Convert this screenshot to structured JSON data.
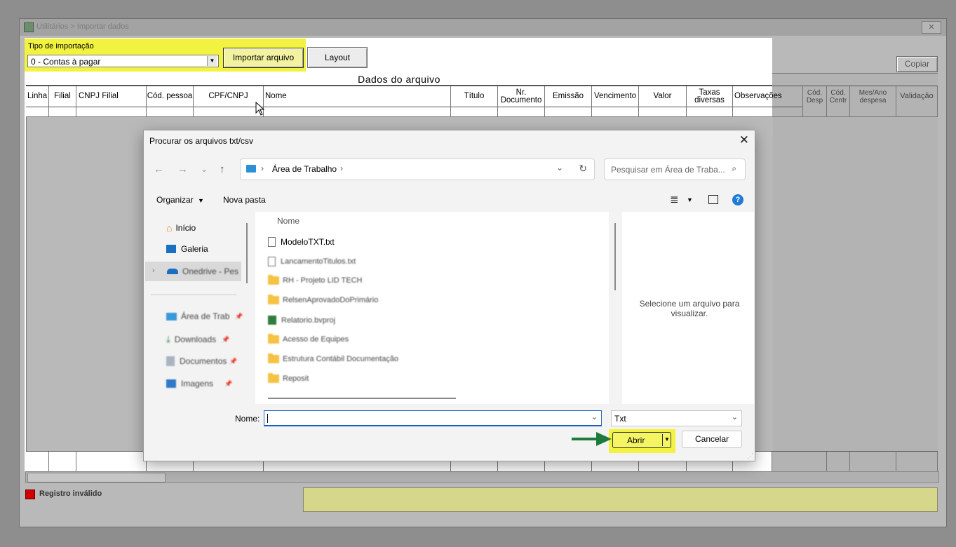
{
  "window": {
    "title": "Utilitários > Importar dados",
    "close_glyph": "✕"
  },
  "toolbar": {
    "import_type_label": "Tipo de importação",
    "import_type_value": "0 - Contas à pagar",
    "import_file_button": "Importar arquivo",
    "layout_button": "Layout",
    "copy_button": "Copiar"
  },
  "grid": {
    "title": "Dados do arquivo",
    "columns": [
      "Linha",
      "Filial",
      "CNPJ Filial",
      "Cód. pessoa",
      "CPF/CNPJ",
      "Nome",
      "Título",
      "Nr.\nDocumento",
      "Emissão",
      "Vencimento",
      "Valor",
      "Taxas\ndiversas",
      "Observações",
      "Cód.\nDesp",
      "Cód.\nCentr",
      "Mes/Ano\ndespesa",
      "Validação"
    ]
  },
  "legend": {
    "invalid_label": "Registro inválido",
    "invalid_color": "#e00000"
  },
  "dialog": {
    "title": "Procurar os arquivos txt/csv",
    "address_location": "Área de Trabalho",
    "search_placeholder": "Pesquisar em Área de Traba...",
    "organize_label": "Organizar",
    "new_folder_label": "Nova pasta",
    "nav_items": [
      {
        "label": "Início",
        "icon": "home-icon"
      },
      {
        "label": "Galeria",
        "icon": "gallery-icon"
      },
      {
        "label": "Onedrive - Pes",
        "icon": "onedrive-icon"
      },
      {
        "label": "Área de Trab",
        "icon": "desktop-icon"
      },
      {
        "label": "Downloads",
        "icon": "download-icon"
      },
      {
        "label": "Documentos",
        "icon": "documents-icon"
      },
      {
        "label": "Imagens",
        "icon": "images-icon"
      }
    ],
    "column_header": "Nome",
    "files": [
      {
        "name": "ModeloTXT.txt",
        "type": "txt"
      },
      {
        "name": "LancamentoTitulos.txt",
        "type": "txt"
      },
      {
        "name": "RH - Projeto LID TECH",
        "type": "folder"
      },
      {
        "name": "RelsenAprovadoDoPrimário",
        "type": "folder"
      },
      {
        "name": "Relatorio.bvproj",
        "type": "project"
      },
      {
        "name": "Acesso de Equipes",
        "type": "folder"
      },
      {
        "name": "Estrutura Contábil Documentação",
        "type": "folder"
      },
      {
        "name": "Reposit",
        "type": "folder"
      }
    ],
    "preview_text": "Selecione um arquivo para visualizar.",
    "filename_label": "Nome:",
    "filename_value": "",
    "filetype_value": "Txt",
    "open_button": "Abrir",
    "cancel_button": "Cancelar",
    "highlight_color": "#f2f240",
    "arrow_color": "#1e7a3c"
  }
}
